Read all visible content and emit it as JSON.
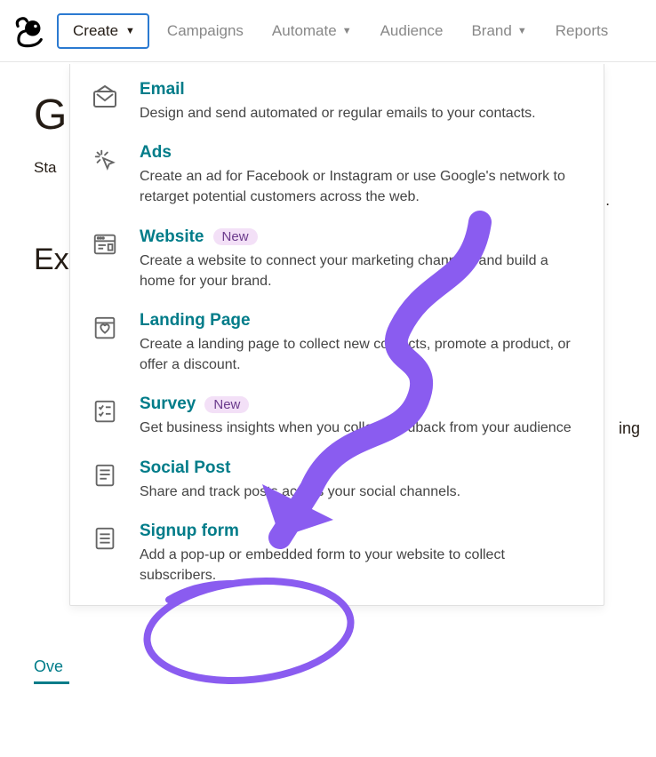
{
  "nav": {
    "create": "Create",
    "items": [
      "Campaigns",
      "Automate",
      "Audience",
      "Brand",
      "Reports"
    ],
    "has_chevron": [
      false,
      true,
      false,
      true,
      false
    ]
  },
  "bg": {
    "g": "G",
    "sta": "Sta",
    "ex": "Ex",
    "ing": "ing",
    "ove": "Ove",
    "dot": "."
  },
  "menu": [
    {
      "icon": "email-icon",
      "title": "Email",
      "badge": null,
      "desc": "Design and send automated or regular emails to your contacts."
    },
    {
      "icon": "ads-icon",
      "title": "Ads",
      "badge": null,
      "desc": "Create an ad for Facebook or Instagram or use Google's network to retarget potential customers across the web."
    },
    {
      "icon": "website-icon",
      "title": "Website",
      "badge": "New",
      "desc": "Create a website to connect your marketing channels and build a home for your brand."
    },
    {
      "icon": "landing-page-icon",
      "title": "Landing Page",
      "badge": null,
      "desc": "Create a landing page to collect new contacts, promote a product, or offer a discount."
    },
    {
      "icon": "survey-icon",
      "title": "Survey",
      "badge": "New",
      "desc": "Get business insights when you collect feedback from your audience"
    },
    {
      "icon": "social-post-icon",
      "title": "Social Post",
      "badge": null,
      "desc": "Share and track posts across your social channels."
    },
    {
      "icon": "signup-form-icon",
      "title": "Signup form",
      "badge": null,
      "desc": "Add a pop-up or embedded form to your website to collect subscribers."
    }
  ],
  "colors": {
    "teal": "#007c89",
    "purple_annotation": "#8a5cf0"
  }
}
